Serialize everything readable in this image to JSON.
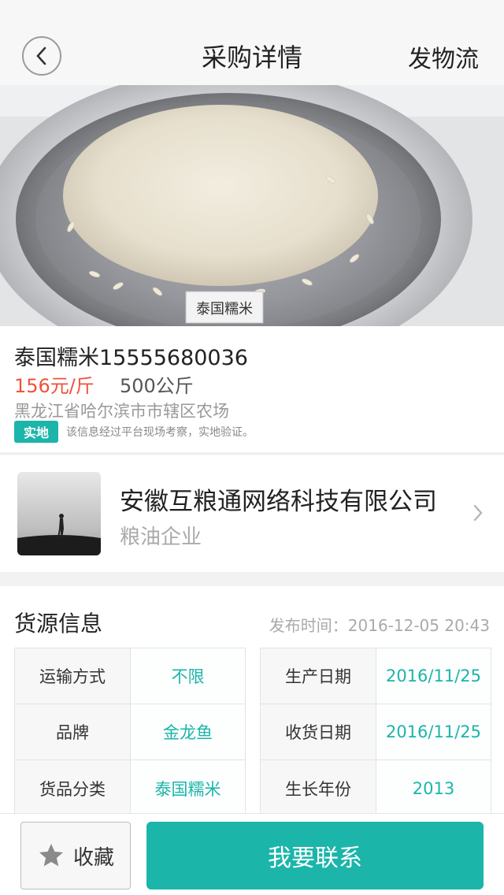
{
  "nav": {
    "title": "采购详情",
    "right_action": "发物流"
  },
  "hero": {
    "label_text": "泰国糯米"
  },
  "product": {
    "title": "泰国糯米15555680036",
    "price": "156元/斤",
    "quantity": "500公斤",
    "address": "黑龙江省哈尔滨市市辖区农场",
    "badge": "实地",
    "badge_note": "该信息经过平台现场考察，实地验证。"
  },
  "company": {
    "name": "安徽互粮通网络科技有限公司",
    "type": "粮油企业"
  },
  "supply": {
    "title": "货源信息",
    "publish_time": "发布时间：2016-12-05 20:43",
    "left_rows": [
      {
        "key": "运输方式",
        "value": "不限"
      },
      {
        "key": "品牌",
        "value": "金龙鱼"
      },
      {
        "key": "货品分类",
        "value": "泰国糯米"
      }
    ],
    "right_rows": [
      {
        "key": "生产日期",
        "value": "2016/11/25"
      },
      {
        "key": "收货日期",
        "value": "2016/11/25"
      },
      {
        "key": "生长年份",
        "value": "2013"
      }
    ]
  },
  "bottom": {
    "favorite_label": "收藏",
    "contact_label": "我要联系"
  },
  "colors": {
    "accent": "#1bb5aa",
    "price": "#f0523b"
  }
}
